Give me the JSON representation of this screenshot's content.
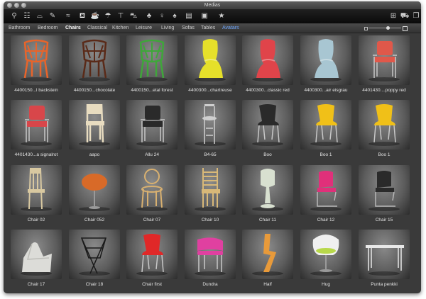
{
  "window": {
    "title": "Medias"
  },
  "toolbar": {
    "left_icons": [
      {
        "name": "lamp-icon",
        "glyph": "⚲"
      },
      {
        "name": "shelf-icon",
        "glyph": "☷"
      },
      {
        "name": "bathtub-icon",
        "glyph": "⌓"
      },
      {
        "name": "paintbrush-icon",
        "glyph": "✎"
      },
      {
        "name": "lines-icon",
        "glyph": "≈"
      },
      {
        "name": "sofa-icon",
        "glyph": "⛾"
      },
      {
        "name": "cup-icon",
        "glyph": "☕"
      },
      {
        "name": "umbrella-icon",
        "glyph": "☂"
      },
      {
        "name": "table-icon",
        "glyph": "⊤"
      },
      {
        "name": "car-icon",
        "glyph": "⛍"
      },
      {
        "name": "leaf-icon",
        "glyph": "♣"
      },
      {
        "name": "person-icon",
        "glyph": "♀"
      },
      {
        "name": "tree-icon",
        "glyph": "♠"
      },
      {
        "name": "list-icon",
        "glyph": "▤"
      },
      {
        "name": "image-icon",
        "glyph": "▣"
      },
      {
        "name": "star-icon",
        "glyph": "★"
      }
    ],
    "right_icons": [
      {
        "name": "add-icon",
        "glyph": "⊞"
      },
      {
        "name": "cart-icon",
        "glyph": "⛟"
      },
      {
        "name": "pages-icon",
        "glyph": "❐"
      }
    ]
  },
  "tabs": [
    {
      "label": "Bathroom",
      "state": "normal"
    },
    {
      "label": "Bedroom",
      "state": "normal"
    },
    {
      "label": "Chairs",
      "state": "active"
    },
    {
      "label": "Classical",
      "state": "normal"
    },
    {
      "label": "Kitchen",
      "state": "normal"
    },
    {
      "label": "Leisure",
      "state": "normal"
    },
    {
      "label": "Living",
      "state": "normal"
    },
    {
      "label": "Sofas",
      "state": "normal"
    },
    {
      "label": "Tables",
      "state": "normal"
    },
    {
      "label": "Avatars",
      "state": "special"
    }
  ],
  "zoom": {
    "level": 0.6
  },
  "items": [
    {
      "label": "4400150...l backstein",
      "color": "#e8642a",
      "shape": "wire"
    },
    {
      "label": "4400150...chocolate",
      "color": "#5a2a18",
      "shape": "wire"
    },
    {
      "label": "4400150...etal forest",
      "color": "#3fa63a",
      "shape": "wire"
    },
    {
      "label": "4400300...chartreuse",
      "color": "#e6e02a",
      "shape": "panton"
    },
    {
      "label": "4400300...classic red",
      "color": "#e0444a",
      "shape": "panton"
    },
    {
      "label": "4400300...air eisgrau",
      "color": "#a8c6d2",
      "shape": "panton"
    },
    {
      "label": "4401430....poppy red",
      "color": "#e0584a",
      "shape": "armchair"
    },
    {
      "label": "4401430...a signalrot",
      "color": "#d8464a",
      "shape": "armchair"
    },
    {
      "label": "aapo",
      "color": "#e8dcc0",
      "shape": "wood"
    },
    {
      "label": "Allu 24",
      "color": "#2a2a2a",
      "shape": "armchair"
    },
    {
      "label": "B4-65",
      "color": "#cfcfcf",
      "shape": "stool"
    },
    {
      "label": "Boo",
      "color": "#2a2a2a",
      "shape": "shell"
    },
    {
      "label": "Boo 1",
      "color": "#f0c018",
      "shape": "shell"
    },
    {
      "label": "Boo 1",
      "color": "#f0c018",
      "shape": "shell"
    },
    {
      "label": "Chair 02",
      "color": "#d8c8a0",
      "shape": "highback"
    },
    {
      "label": "Chair 052",
      "color": "#d86a28",
      "shape": "pedestal"
    },
    {
      "label": "Chair 07",
      "color": "#d8b070",
      "shape": "bentwood"
    },
    {
      "label": "Chair 10",
      "color": "#d8b878",
      "shape": "ladder"
    },
    {
      "label": "Chair 11",
      "color": "#d8e0d0",
      "shape": "tulip"
    },
    {
      "label": "Chair 12",
      "color": "#e0307a",
      "shape": "cantilever"
    },
    {
      "label": "Chair 15",
      "color": "#2a2a2a",
      "shape": "cantilever"
    },
    {
      "label": "Chair 17",
      "color": "#dcdcd8",
      "shape": "lounge"
    },
    {
      "label": "Chair 18",
      "color": "#1a1a1a",
      "shape": "butterfly"
    },
    {
      "label": "Chair first",
      "color": "#e02828",
      "shape": "shell"
    },
    {
      "label": "Dundra",
      "color": "#e040a0",
      "shape": "bench"
    },
    {
      "label": "Half",
      "color": "#e89a3a",
      "shape": "zigzag"
    },
    {
      "label": "Hug",
      "color": "#f0f0f0",
      "shape": "hug"
    },
    {
      "label": "Punta penkki",
      "color": "#e8e8e8",
      "shape": "table"
    }
  ]
}
